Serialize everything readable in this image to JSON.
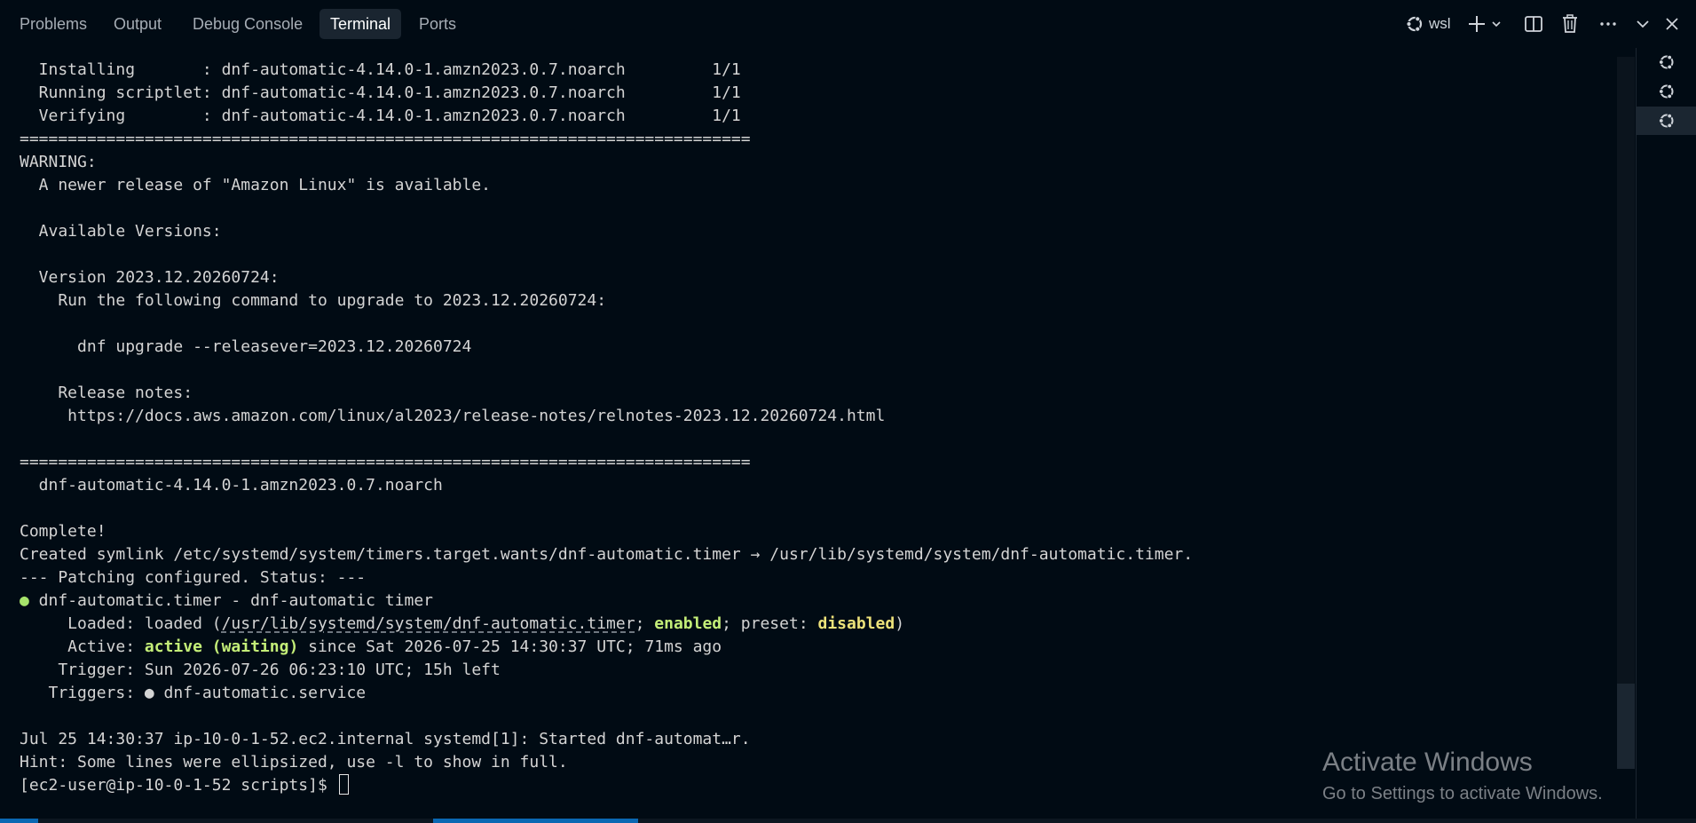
{
  "tabs": [
    {
      "label": "Problems"
    },
    {
      "label": "Output"
    },
    {
      "label": "Debug Console"
    },
    {
      "label": "Terminal",
      "active": true
    },
    {
      "label": "Ports"
    }
  ],
  "toolbar": {
    "profile_label": "wsl",
    "profile_icon": "ubuntu-icon",
    "new_terminal_icon": "plus-icon",
    "dropdown_icon": "chevron-down-icon",
    "split_icon": "split-editor-icon",
    "kill_icon": "trash-icon",
    "more_icon": "ellipsis-icon",
    "maximize_icon": "chevron-down-icon",
    "close_icon": "close-icon"
  },
  "terminal": {
    "l01": "  Installing       : dnf-automatic-4.14.0-1.amzn2023.0.7.noarch         1/1",
    "l02": "  Running scriptlet: dnf-automatic-4.14.0-1.amzn2023.0.7.noarch         1/1",
    "l03": "  Verifying        : dnf-automatic-4.14.0-1.amzn2023.0.7.noarch         1/1",
    "l04": "============================================================================",
    "l05": "WARNING:",
    "l06": "  A newer release of \"Amazon Linux\" is available.",
    "l07": "",
    "l08": "  Available Versions:",
    "l09": "",
    "l10": "  Version 2023.12.20260724:",
    "l11": "    Run the following command to upgrade to 2023.12.20260724:",
    "l12": "",
    "l13": "      dnf upgrade --releasever=2023.12.20260724",
    "l14": "",
    "l15": "    Release notes:",
    "l16": "     https://docs.aws.amazon.com/linux/al2023/release-notes/relnotes-2023.12.20260724.html",
    "l17": "",
    "l18": "============================================================================",
    "l19": "  dnf-automatic-4.14.0-1.amzn2023.0.7.noarch",
    "l20": "",
    "l21": "Complete!",
    "l22": "Created symlink /etc/systemd/system/timers.target.wants/dnf-automatic.timer → /usr/lib/systemd/system/dnf-automatic.timer.",
    "l23": "--- Patching configured. Status: ---",
    "l24_dot": "●",
    "l24_rest": " dnf-automatic.timer - dnf-automatic timer",
    "l25_a": "     Loaded: loaded (",
    "l25_path": "/usr/lib/systemd/system/dnf-automatic.timer",
    "l25_b": "; ",
    "l25_enabled": "enabled",
    "l25_c": "; preset: ",
    "l25_disabled": "disabled",
    "l25_d": ")",
    "l26_a": "     Active: ",
    "l26_active": "active (waiting)",
    "l26_b": " since Sat 2026-07-25 14:30:37 UTC; 71ms ago",
    "l27": "    Trigger: Sun 2026-07-26 06:23:10 UTC; 15h left",
    "l28": "   Triggers: ● dnf-automatic.service",
    "l29": "",
    "l30": "Jul 25 14:30:37 ip-10-0-1-52.ec2.internal systemd[1]: Started dnf-automat…r.",
    "l31": "Hint: Some lines were ellipsized, use -l to show in full.",
    "l32": "[ec2-user@ip-10-0-1-52 scripts]$ "
  },
  "terminal_list": [
    {
      "icon": "ubuntu-icon",
      "active": false
    },
    {
      "icon": "ubuntu-icon",
      "active": false
    },
    {
      "icon": "ubuntu-icon",
      "active": true
    }
  ],
  "watermark": {
    "title": "Activate Windows",
    "subtitle": "Go to Settings to activate Windows."
  },
  "colors": {
    "background": "#010b14",
    "accent_blue": "#0a68b3",
    "enabled_green": "#c4ee78",
    "disabled_yellow": "#ede27a"
  }
}
